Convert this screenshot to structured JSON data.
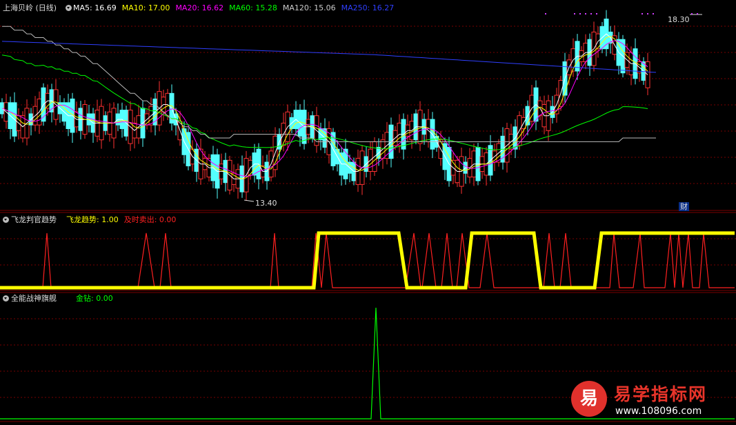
{
  "main_panel": {
    "title": "上海贝岭 (日线)",
    "ma_legend": [
      {
        "label": "MA5: 16.69",
        "color": "#ffffff"
      },
      {
        "label": "MA10: 17.00",
        "color": "#ffff00"
      },
      {
        "label": "MA20: 16.62",
        "color": "#ff00ff"
      },
      {
        "label": "MA60: 15.28",
        "color": "#00ff00"
      },
      {
        "label": "MA120: 15.06",
        "color": "#cccccc"
      },
      {
        "label": "MA250: 16.27",
        "color": "#2f3fff"
      }
    ],
    "high_label": "18.30",
    "low_label": "13.40",
    "cai_marker": "财"
  },
  "indicator1": {
    "name": "飞龙判官趋势",
    "legend": [
      {
        "label": "飞龙趋势: 1.00",
        "color": "#ffff00"
      },
      {
        "label": "及时卖出: 0.00",
        "color": "#ff2020"
      }
    ]
  },
  "indicator2": {
    "name": "全能战神旗舰",
    "legend": [
      {
        "label": "金钻: 0.00",
        "color": "#00ff00"
      }
    ]
  },
  "watermark": {
    "badge": "易",
    "title": "易学指标网",
    "url": "www.108096.com"
  },
  "colors": {
    "up": "#ff3232",
    "down": "#54ffff",
    "grid": "#7a0000",
    "ma5": "#ffffff",
    "ma10": "#ffff00",
    "ma20": "#ff00ff",
    "ma60": "#00ff00",
    "ma120": "#bbbbbb",
    "ma250": "#2f3fff",
    "trend": "#ffff00",
    "sell": "#ff2020",
    "gold": "#00ff00"
  },
  "chart_data": [
    {
      "type": "line",
      "title": "上海贝岭 (日线)",
      "ylim": [
        13.2,
        18.6
      ],
      "x": [
        0,
        6,
        12,
        18,
        24,
        30,
        36,
        42,
        48,
        54,
        60,
        66,
        72,
        78,
        84,
        90,
        96,
        102,
        108,
        114,
        120,
        126,
        132,
        138,
        144,
        150,
        156,
        162,
        168,
        174,
        180,
        186,
        192,
        198,
        204,
        210,
        216,
        222,
        228,
        234,
        240,
        246,
        252,
        258,
        264,
        270,
        276,
        282,
        288,
        294,
        300,
        306,
        312,
        318,
        324,
        330,
        336,
        342,
        348,
        354,
        360,
        366,
        372,
        378,
        384,
        390,
        396,
        402,
        408,
        414,
        420,
        426,
        432,
        438,
        444,
        450,
        456,
        462,
        468,
        474,
        480,
        486,
        492,
        498,
        504,
        510,
        516,
        522,
        528,
        534,
        540,
        546,
        552,
        558,
        564,
        570,
        576,
        582,
        588,
        594,
        600,
        606,
        612,
        618,
        624,
        630,
        636,
        642,
        648,
        654,
        660,
        666,
        672,
        678,
        684,
        690,
        696,
        702,
        708,
        714,
        720,
        726,
        732,
        738,
        744,
        750,
        756,
        762,
        768,
        774,
        780,
        786,
        792,
        798,
        804,
        810,
        816,
        822,
        828,
        834,
        840,
        846,
        852,
        858,
        864,
        870,
        876,
        882,
        888,
        894,
        900,
        906,
        912,
        918,
        924,
        930,
        936,
        942,
        948,
        954,
        960,
        966,
        972,
        978,
        984,
        990,
        996,
        1002,
        1008,
        1014,
        1020,
        1026,
        1032,
        1038,
        1044,
        1050,
        1056,
        1062
      ],
      "series": [
        {
          "name": "MA5",
          "values": [
            15.8,
            15.7,
            15.6,
            15.5,
            15.4,
            15.3,
            15.4,
            15.5,
            15.6,
            15.7,
            15.9,
            16.0,
            16.0,
            15.9,
            15.8,
            15.7,
            15.6,
            15.6,
            15.5,
            15.5,
            15.5,
            15.5,
            15.4,
            15.4,
            15.4,
            15.4,
            15.4,
            15.4,
            15.5,
            15.5,
            15.4,
            15.3,
            15.2,
            15.3,
            15.4,
            15.5,
            15.6,
            15.7,
            15.8,
            15.9,
            15.9,
            15.8,
            15.5,
            15.2,
            14.9,
            14.7,
            14.5,
            14.4,
            14.3,
            14.3,
            14.2,
            14.2,
            14.1,
            14.1,
            14.1,
            14.0,
            13.9,
            13.9,
            13.9,
            14.0,
            14.2,
            14.3,
            14.3,
            14.1,
            14.1,
            14.3,
            14.6,
            14.9,
            15.1,
            15.3,
            15.4,
            15.5,
            15.4,
            15.3,
            15.3,
            15.3,
            15.2,
            15.1,
            15.0,
            14.9,
            14.7,
            14.5,
            14.3,
            14.3,
            14.2,
            14.1,
            14.1,
            14.2,
            14.3,
            14.4,
            14.5,
            14.6,
            14.7,
            14.8,
            14.9,
            15.0,
            15.1,
            15.1,
            15.2,
            15.2,
            15.3,
            15.3,
            15.3,
            15.2,
            15.1,
            14.9,
            14.7,
            14.5,
            14.3,
            14.2,
            14.1,
            14.1,
            14.2,
            14.2,
            14.3,
            14.3,
            14.3,
            14.3,
            14.4,
            14.5,
            14.6,
            14.7,
            14.8,
            14.9,
            15.0,
            15.2,
            15.4,
            15.6,
            15.8,
            15.9,
            15.8,
            15.6,
            15.6,
            15.7,
            15.9,
            16.2,
            16.6,
            16.9,
            17.1,
            17.2,
            17.2,
            17.3,
            17.3,
            17.4,
            17.6,
            17.7,
            17.8,
            17.7,
            17.5,
            17.3,
            17.2,
            17.1,
            17.0,
            17.0,
            16.9,
            16.8,
            16.7
          ]
        },
        {
          "name": "MA120",
          "values": [
            18.0,
            18.0,
            18.0,
            17.9,
            17.9,
            17.9,
            17.8,
            17.8,
            17.7,
            17.7,
            17.7,
            17.6,
            17.6,
            17.5,
            17.5,
            17.4,
            17.4,
            17.3,
            17.3,
            17.2,
            17.2,
            17.1,
            17.0,
            17.0,
            16.9,
            16.8,
            16.7,
            16.6,
            16.5,
            16.4,
            16.3,
            16.2,
            16.2,
            16.1,
            16.0,
            16.0,
            15.9,
            15.9,
            15.8,
            15.7,
            15.6,
            15.5,
            15.5,
            15.4,
            15.3,
            15.3,
            15.2,
            15.2,
            15.1,
            15.1,
            15.0,
            15.0,
            15.0,
            15.0,
            15.0,
            15.0,
            15.1,
            15.1,
            15.1,
            15.1,
            15.1,
            15.1,
            15.1,
            15.1,
            15.1,
            15.1,
            15.1,
            15.1,
            15.1,
            15.1,
            15.1,
            15.1,
            15.0,
            15.0,
            15.0,
            15.0,
            14.9,
            14.9,
            14.9,
            14.9,
            14.9,
            14.9,
            14.9,
            14.9,
            14.9,
            14.9,
            14.9,
            14.9,
            14.9,
            14.9,
            14.9,
            14.9,
            14.9,
            14.9,
            14.9,
            14.9,
            14.9,
            14.9,
            14.9,
            14.9,
            14.9,
            14.9,
            14.9,
            14.9,
            14.9,
            14.9,
            14.9,
            14.9,
            14.9,
            14.9,
            14.9,
            14.9,
            14.9,
            14.9,
            14.9,
            14.9,
            14.9,
            14.9,
            14.9,
            14.9,
            14.9,
            14.9,
            14.9,
            14.9,
            14.9,
            14.9,
            14.9,
            14.9,
            14.9,
            14.9,
            14.9,
            14.9,
            14.9,
            14.9,
            14.9,
            14.9,
            14.9,
            14.9,
            14.9,
            14.9,
            14.9,
            14.9,
            14.9,
            14.9,
            14.9,
            14.9,
            14.9,
            14.9,
            14.9,
            14.9,
            15.0,
            15.0,
            15.0,
            15.0,
            15.0,
            15.0,
            15.0,
            15.0,
            15.0
          ]
        }
      ]
    },
    {
      "type": "line",
      "title": "飞龙判官趋势",
      "ylim": [
        0,
        1.1
      ],
      "series": [
        {
          "name": "飞龙趋势",
          "points": [
            [
              0,
              0
            ],
            [
              455,
              0
            ],
            [
              462,
              1
            ],
            [
              578,
              1
            ],
            [
              590,
              0
            ],
            [
              675,
              0
            ],
            [
              684,
              1
            ],
            [
              774,
              1
            ],
            [
              784,
              0
            ],
            [
              862,
              0
            ],
            [
              872,
              1
            ],
            [
              1065,
              1
            ]
          ]
        },
        {
          "name": "及时卖出",
          "points": [
            [
              0,
              0
            ],
            [
              62,
              0
            ],
            [
              68,
              1
            ],
            [
              74,
              0
            ],
            [
              200,
              0
            ],
            [
              212,
              1
            ],
            [
              224,
              0
            ],
            [
              232,
              0
            ],
            [
              240,
              1
            ],
            [
              248,
              0
            ],
            [
              392,
              0
            ],
            [
              398,
              1
            ],
            [
              404,
              0
            ],
            [
              452,
              0
            ],
            [
              458,
              1
            ],
            [
              466,
              0
            ],
            [
              473,
              1
            ],
            [
              482,
              0
            ],
            [
              588,
              0
            ],
            [
              600,
              1
            ],
            [
              610,
              0
            ],
            [
              612,
              0
            ],
            [
              622,
              1
            ],
            [
              632,
              0
            ],
            [
              640,
              0
            ],
            [
              648,
              1
            ],
            [
              656,
              0
            ],
            [
              662,
              0
            ],
            [
              670,
              1
            ],
            [
              680,
              0
            ],
            [
              696,
              0
            ],
            [
              706,
              1
            ],
            [
              716,
              0
            ],
            [
              788,
              0
            ],
            [
              796,
              1
            ],
            [
              804,
              0
            ],
            [
              812,
              0
            ],
            [
              820,
              1
            ],
            [
              828,
              0
            ],
            [
              884,
              0
            ],
            [
              890,
              1
            ],
            [
              898,
              0
            ],
            [
              918,
              0
            ],
            [
              928,
              1
            ],
            [
              934,
              0
            ],
            [
              964,
              0
            ],
            [
              972,
              1
            ],
            [
              978,
              0
            ],
            [
              984,
              1
            ],
            [
              990,
              0
            ],
            [
              998,
              1
            ],
            [
              1004,
              0
            ],
            [
              1014,
              0
            ],
            [
              1020,
              1
            ],
            [
              1028,
              0
            ],
            [
              1065,
              0
            ]
          ]
        }
      ]
    },
    {
      "type": "line",
      "title": "全能战神旗舰",
      "ylim": [
        0,
        1
      ],
      "series": [
        {
          "name": "金钻",
          "points": [
            [
              0,
              0
            ],
            [
              538,
              0
            ],
            [
              545,
              1
            ],
            [
              552,
              0
            ],
            [
              1065,
              0
            ]
          ]
        }
      ]
    }
  ]
}
